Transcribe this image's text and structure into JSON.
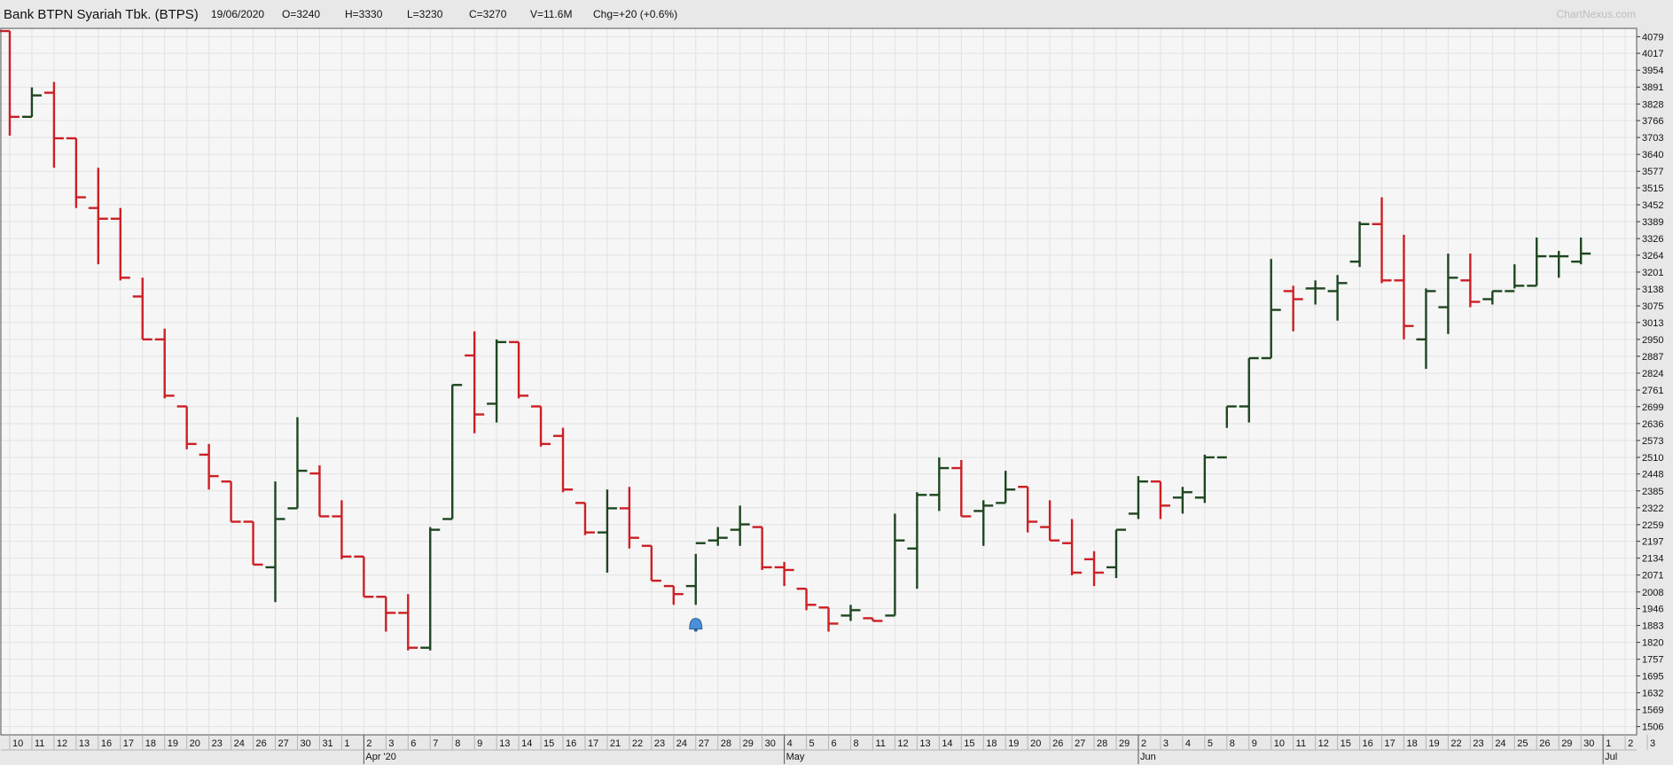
{
  "header": {
    "title": "Bank BTPN Syariah Tbk. (BTPS)",
    "date": "19/06/2020",
    "open": "O=3240",
    "high": "H=3330",
    "low": "L=3230",
    "close": "C=3270",
    "volume": "V=11.6M",
    "change": "Chg=+20 (+0.6%)",
    "brand": "ChartNexus.com"
  },
  "colors": {
    "up": "#1e4620",
    "down": "#cc1f24",
    "grid": "#e2e2e2",
    "plot_bg": "#f6f6f6",
    "frame": "#555555",
    "marker": "#4a90d9"
  },
  "marker_icon": "bell-icon",
  "chart_data": {
    "type": "ohlc",
    "title": "",
    "xlabel": "",
    "ylabel": "",
    "ylim": [
      1475,
      4110
    ],
    "y_ticks": [
      4079,
      4017,
      3954,
      3891,
      3828,
      3766,
      3703,
      3640,
      3577,
      3515,
      3452,
      3389,
      3326,
      3264,
      3201,
      3138,
      3075,
      3013,
      2950,
      2887,
      2824,
      2761,
      2699,
      2636,
      2573,
      2510,
      2448,
      2385,
      2322,
      2259,
      2197,
      2134,
      2071,
      2008,
      1946,
      1883,
      1820,
      1757,
      1695,
      1632,
      1569,
      1506
    ],
    "x_labels": [
      "10",
      "11",
      "12",
      "13",
      "16",
      "17",
      "18",
      "19",
      "20",
      "23",
      "24",
      "26",
      "27",
      "30",
      "31",
      "1",
      "2",
      "3",
      "6",
      "7",
      "8",
      "9",
      "13",
      "14",
      "15",
      "16",
      "17",
      "21",
      "22",
      "23",
      "24",
      "27",
      "28",
      "29",
      "30",
      "4",
      "5",
      "6",
      "8",
      "11",
      "12",
      "13",
      "14",
      "15",
      "18",
      "19",
      "20",
      "26",
      "27",
      "28",
      "29",
      "2",
      "3",
      "4",
      "5",
      "8",
      "9",
      "10",
      "11",
      "12",
      "15",
      "16",
      "17",
      "18",
      "19",
      "22",
      "23",
      "24",
      "25",
      "26",
      "29",
      "30",
      "1",
      "2",
      "3"
    ],
    "month_labels": [
      {
        "label": "Apr '20",
        "index": 16
      },
      {
        "label": "May",
        "index": 35
      },
      {
        "label": "Jun",
        "index": 51
      },
      {
        "label": "Jul",
        "index": 72
      }
    ],
    "marker_index": 31,
    "marker_value": 1883,
    "bars": [
      {
        "o": 4100,
        "h": 4100,
        "l": 3710,
        "c": 3780
      },
      {
        "o": 3780,
        "h": 3890,
        "l": 3780,
        "c": 3860
      },
      {
        "o": 3870,
        "h": 3910,
        "l": 3590,
        "c": 3700
      },
      {
        "o": 3700,
        "h": 3700,
        "l": 3440,
        "c": 3480
      },
      {
        "o": 3440,
        "h": 3590,
        "l": 3230,
        "c": 3400
      },
      {
        "o": 3400,
        "h": 3440,
        "l": 3170,
        "c": 3180
      },
      {
        "o": 3110,
        "h": 3180,
        "l": 2950,
        "c": 2950
      },
      {
        "o": 2950,
        "h": 2990,
        "l": 2730,
        "c": 2740
      },
      {
        "o": 2700,
        "h": 2700,
        "l": 2540,
        "c": 2560
      },
      {
        "o": 2520,
        "h": 2560,
        "l": 2390,
        "c": 2440
      },
      {
        "o": 2420,
        "h": 2420,
        "l": 2270,
        "c": 2270
      },
      {
        "o": 2270,
        "h": 2270,
        "l": 2110,
        "c": 2110
      },
      {
        "o": 2100,
        "h": 2420,
        "l": 1970,
        "c": 2280
      },
      {
        "o": 2320,
        "h": 2660,
        "l": 2320,
        "c": 2460
      },
      {
        "o": 2450,
        "h": 2480,
        "l": 2290,
        "c": 2290
      },
      {
        "o": 2290,
        "h": 2350,
        "l": 2130,
        "c": 2140
      },
      {
        "o": 2140,
        "h": 2140,
        "l": 1990,
        "c": 1990
      },
      {
        "o": 1990,
        "h": 1990,
        "l": 1860,
        "c": 1930
      },
      {
        "o": 1930,
        "h": 2000,
        "l": 1790,
        "c": 1800
      },
      {
        "o": 1800,
        "h": 2250,
        "l": 1790,
        "c": 2240
      },
      {
        "o": 2280,
        "h": 2780,
        "l": 2280,
        "c": 2780
      },
      {
        "o": 2890,
        "h": 2980,
        "l": 2600,
        "c": 2670
      },
      {
        "o": 2710,
        "h": 2950,
        "l": 2640,
        "c": 2940
      },
      {
        "o": 2940,
        "h": 2940,
        "l": 2730,
        "c": 2740
      },
      {
        "o": 2700,
        "h": 2700,
        "l": 2550,
        "c": 2560
      },
      {
        "o": 2590,
        "h": 2620,
        "l": 2380,
        "c": 2390
      },
      {
        "o": 2340,
        "h": 2340,
        "l": 2220,
        "c": 2230
      },
      {
        "o": 2230,
        "h": 2390,
        "l": 2080,
        "c": 2320
      },
      {
        "o": 2320,
        "h": 2400,
        "l": 2170,
        "c": 2210
      },
      {
        "o": 2180,
        "h": 2180,
        "l": 2050,
        "c": 2050
      },
      {
        "o": 2030,
        "h": 2030,
        "l": 1960,
        "c": 2000
      },
      {
        "o": 2030,
        "h": 2150,
        "l": 1960,
        "c": 2190
      },
      {
        "o": 2200,
        "h": 2250,
        "l": 2180,
        "c": 2210
      },
      {
        "o": 2240,
        "h": 2330,
        "l": 2180,
        "c": 2260
      },
      {
        "o": 2250,
        "h": 2250,
        "l": 2090,
        "c": 2100
      },
      {
        "o": 2100,
        "h": 2120,
        "l": 2030,
        "c": 2090
      },
      {
        "o": 2020,
        "h": 2020,
        "l": 1940,
        "c": 1960
      },
      {
        "o": 1950,
        "h": 1950,
        "l": 1860,
        "c": 1890
      },
      {
        "o": 1920,
        "h": 1960,
        "l": 1900,
        "c": 1940
      },
      {
        "o": 1910,
        "h": 1910,
        "l": 1900,
        "c": 1900
      },
      {
        "o": 1920,
        "h": 2300,
        "l": 1920,
        "c": 2200
      },
      {
        "o": 2170,
        "h": 2380,
        "l": 2020,
        "c": 2370
      },
      {
        "o": 2370,
        "h": 2510,
        "l": 2310,
        "c": 2470
      },
      {
        "o": 2470,
        "h": 2500,
        "l": 2290,
        "c": 2290
      },
      {
        "o": 2310,
        "h": 2350,
        "l": 2180,
        "c": 2330
      },
      {
        "o": 2340,
        "h": 2460,
        "l": 2340,
        "c": 2390
      },
      {
        "o": 2400,
        "h": 2400,
        "l": 2230,
        "c": 2270
      },
      {
        "o": 2250,
        "h": 2350,
        "l": 2200,
        "c": 2200
      },
      {
        "o": 2190,
        "h": 2280,
        "l": 2070,
        "c": 2080
      },
      {
        "o": 2130,
        "h": 2160,
        "l": 2030,
        "c": 2080
      },
      {
        "o": 2100,
        "h": 2240,
        "l": 2060,
        "c": 2240
      },
      {
        "o": 2300,
        "h": 2440,
        "l": 2280,
        "c": 2420
      },
      {
        "o": 2420,
        "h": 2420,
        "l": 2280,
        "c": 2330
      },
      {
        "o": 2360,
        "h": 2400,
        "l": 2300,
        "c": 2380
      },
      {
        "o": 2360,
        "h": 2520,
        "l": 2340,
        "c": 2510
      },
      {
        "o": 2510,
        "h": 2700,
        "l": 2620,
        "c": 2700
      },
      {
        "o": 2700,
        "h": 2880,
        "l": 2640,
        "c": 2880
      },
      {
        "o": 2880,
        "h": 3250,
        "l": 2880,
        "c": 3060
      },
      {
        "o": 3130,
        "h": 3150,
        "l": 2980,
        "c": 3100
      },
      {
        "o": 3140,
        "h": 3170,
        "l": 3080,
        "c": 3140
      },
      {
        "o": 3130,
        "h": 3190,
        "l": 3020,
        "c": 3160
      },
      {
        "o": 3240,
        "h": 3390,
        "l": 3220,
        "c": 3380
      },
      {
        "o": 3380,
        "h": 3480,
        "l": 3160,
        "c": 3170
      },
      {
        "o": 3170,
        "h": 3340,
        "l": 2950,
        "c": 3000
      },
      {
        "o": 2950,
        "h": 3140,
        "l": 2840,
        "c": 3130
      },
      {
        "o": 3070,
        "h": 3270,
        "l": 2970,
        "c": 3180
      },
      {
        "o": 3170,
        "h": 3270,
        "l": 3070,
        "c": 3090
      },
      {
        "o": 3100,
        "h": 3130,
        "l": 3080,
        "c": 3130
      },
      {
        "o": 3130,
        "h": 3230,
        "l": 3140,
        "c": 3150
      },
      {
        "o": 3150,
        "h": 3330,
        "l": 3150,
        "c": 3260
      },
      {
        "o": 3260,
        "h": 3280,
        "l": 3180,
        "c": 3260
      },
      {
        "o": 3240,
        "h": 3330,
        "l": 3230,
        "c": 3270
      }
    ]
  }
}
